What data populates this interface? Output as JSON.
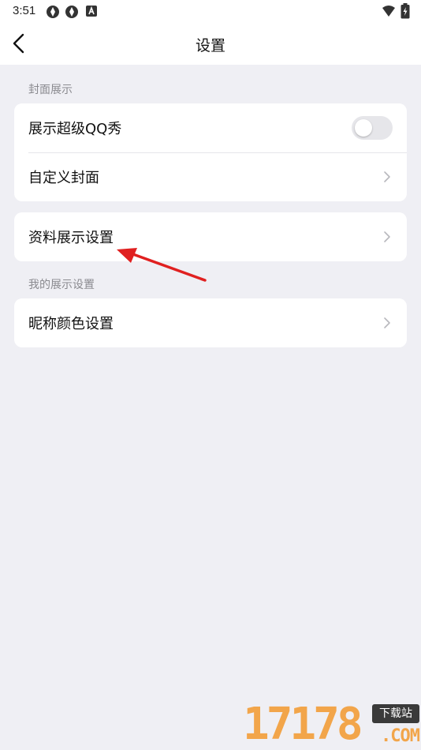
{
  "statusbar": {
    "time": "3:51",
    "icons_left": [
      "vpn-icon",
      "vpn-icon",
      "notification-a-icon"
    ],
    "icons_right": [
      "wifi-icon",
      "battery-charging-icon"
    ]
  },
  "navbar": {
    "back_icon": "chevron-left-icon",
    "title": "设置"
  },
  "sections": {
    "cover": {
      "header": "封面展示",
      "items": [
        {
          "label": "展示超级QQ秀",
          "control": "toggle",
          "toggle_on": false
        },
        {
          "label": "自定义封面",
          "control": "chevron"
        }
      ]
    },
    "profile": {
      "items": [
        {
          "label": "资料展示设置",
          "control": "chevron"
        }
      ]
    },
    "my_display": {
      "header": "我的展示设置",
      "items": [
        {
          "label": "昵称颜色设置",
          "control": "chevron"
        }
      ]
    }
  },
  "annotation": {
    "arrow_color": "#e02020"
  },
  "watermark": {
    "number": "17178",
    "badge": "下载站",
    "domain": ".COM"
  },
  "colors": {
    "background": "#efeff4",
    "card": "#ffffff",
    "secondary_text": "#8a8a8f",
    "watermark": "#f2a54a"
  }
}
